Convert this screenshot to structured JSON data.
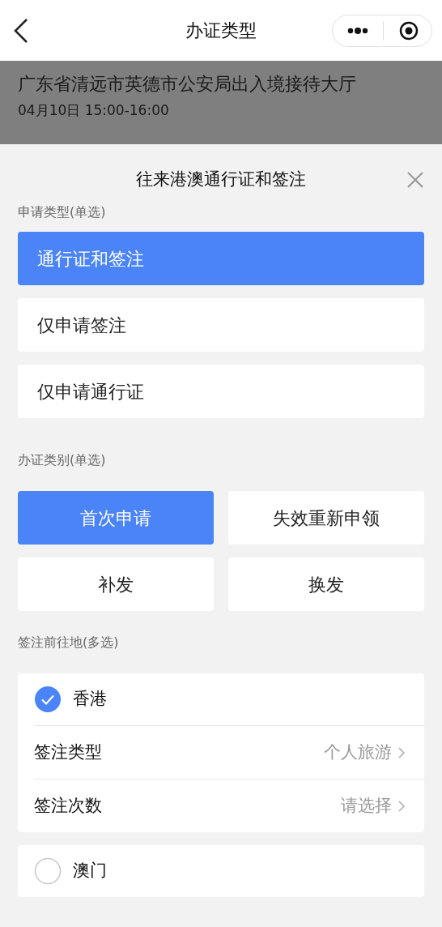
{
  "nav": {
    "title": "办证类型"
  },
  "background": {
    "venue": "广东省清远市英德市公安局出入境接待大厅",
    "time": "04月10日 15:00-16:00"
  },
  "sheet": {
    "title": "往来港澳通行证和签注",
    "apply_type": {
      "label": "申请类型(单选)",
      "options": [
        {
          "label": "通行证和签注",
          "selected": true
        },
        {
          "label": "仅申请签注",
          "selected": false
        },
        {
          "label": "仅申请通行证",
          "selected": false
        }
      ]
    },
    "category": {
      "label": "办证类别(单选)",
      "options": [
        {
          "label": "首次申请",
          "selected": true
        },
        {
          "label": "失效重新申领",
          "selected": false
        },
        {
          "label": "补发",
          "selected": false
        },
        {
          "label": "换发",
          "selected": false
        }
      ]
    },
    "destinations": {
      "label": "签注前往地(多选)",
      "items": [
        {
          "name": "香港",
          "checked": true,
          "fields": [
            {
              "label": "签注类型",
              "value": "个人旅游"
            },
            {
              "label": "签注次数",
              "value": "请选择"
            }
          ]
        },
        {
          "name": "澳门",
          "checked": false
        }
      ]
    }
  }
}
